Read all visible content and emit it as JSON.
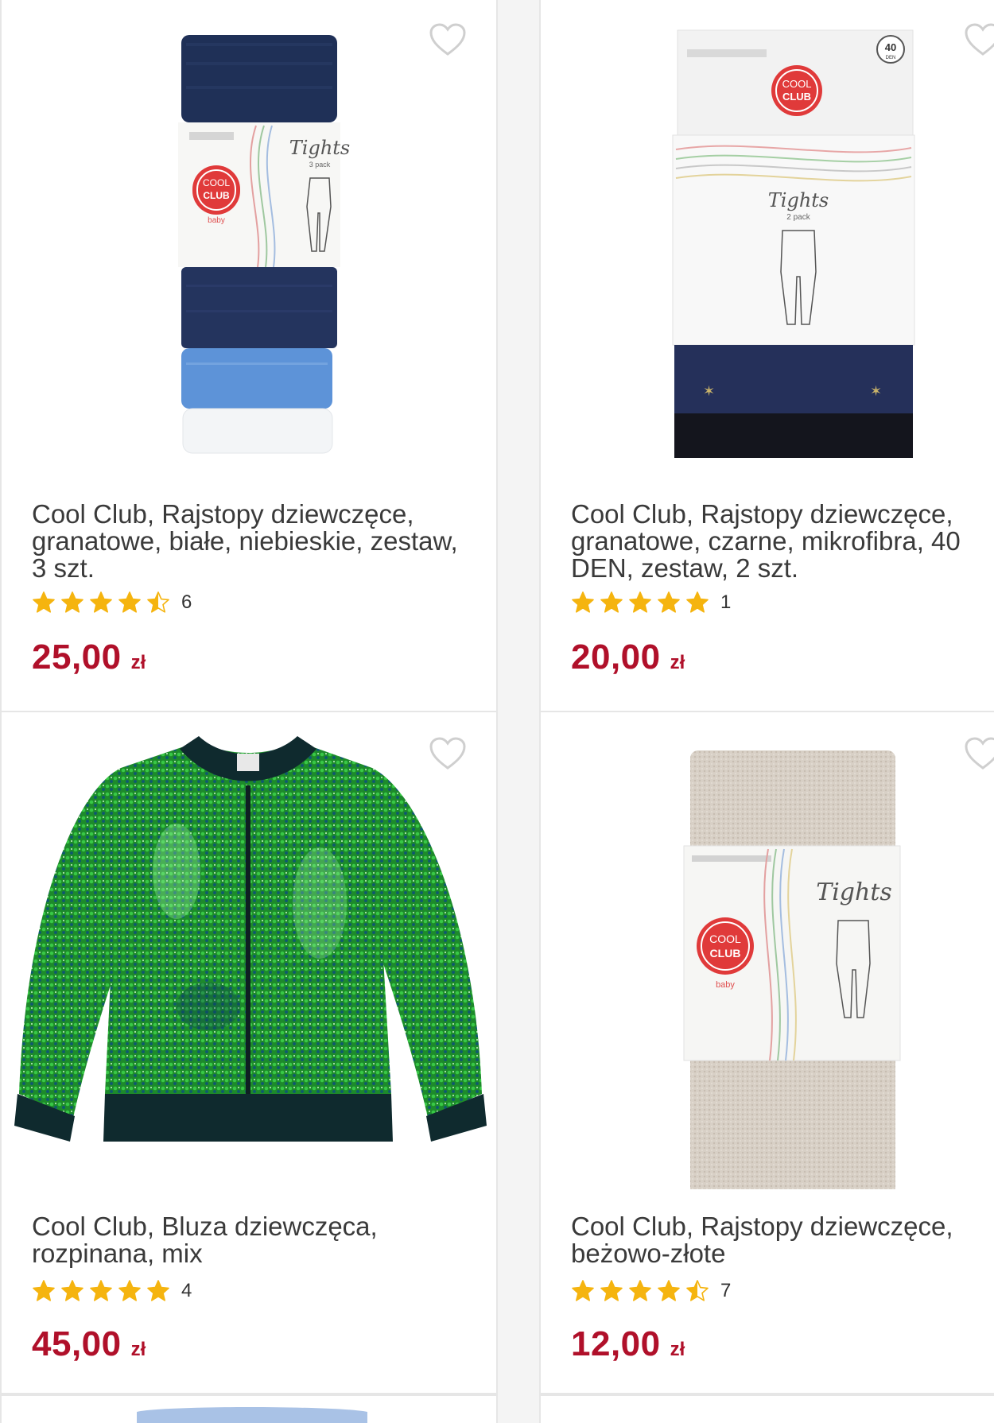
{
  "colors": {
    "price": "#b0102a",
    "star": "#f5b40f",
    "heart": "#cfcfcf",
    "brand_red": "#e03a3a"
  },
  "products": [
    {
      "title": "Cool Club, Rajstopy dziewczęce, granatowe, białe, niebieskie, zestaw, 3 szt.",
      "rating": 4.5,
      "rating_count": "6",
      "price": "25,00",
      "currency": "zł",
      "image": {
        "brand_badge_line1": "COOL",
        "brand_badge_line2": "CLUB",
        "brand_sub": "baby",
        "label_title": "Tights",
        "label_sub": "3 pack"
      }
    },
    {
      "title": "Cool Club, Rajstopy dziewczęce, granatowe, czarne, mikrofibra, 40 DEN, zestaw, 2 szt.",
      "rating": 5,
      "rating_count": "1",
      "price": "20,00",
      "currency": "zł",
      "image": {
        "brand_badge_line1": "COOL",
        "brand_badge_line2": "CLUB",
        "label_title": "Tights",
        "label_sub": "2 pack",
        "den_badge": "40",
        "den_badge_sub": "DEN"
      }
    },
    {
      "title": "Cool Club, Bluza dziewczęca, rozpinana, mix",
      "rating": 5,
      "rating_count": "4",
      "price": "45,00",
      "currency": "zł"
    },
    {
      "title": "Cool Club, Rajstopy dziewczęce, beżowo-złote",
      "rating": 4.5,
      "rating_count": "7",
      "price": "12,00",
      "currency": "zł",
      "image": {
        "brand_badge_line1": "COOL",
        "brand_badge_line2": "CLUB",
        "brand_sub": "baby",
        "label_title": "Tights"
      }
    }
  ]
}
